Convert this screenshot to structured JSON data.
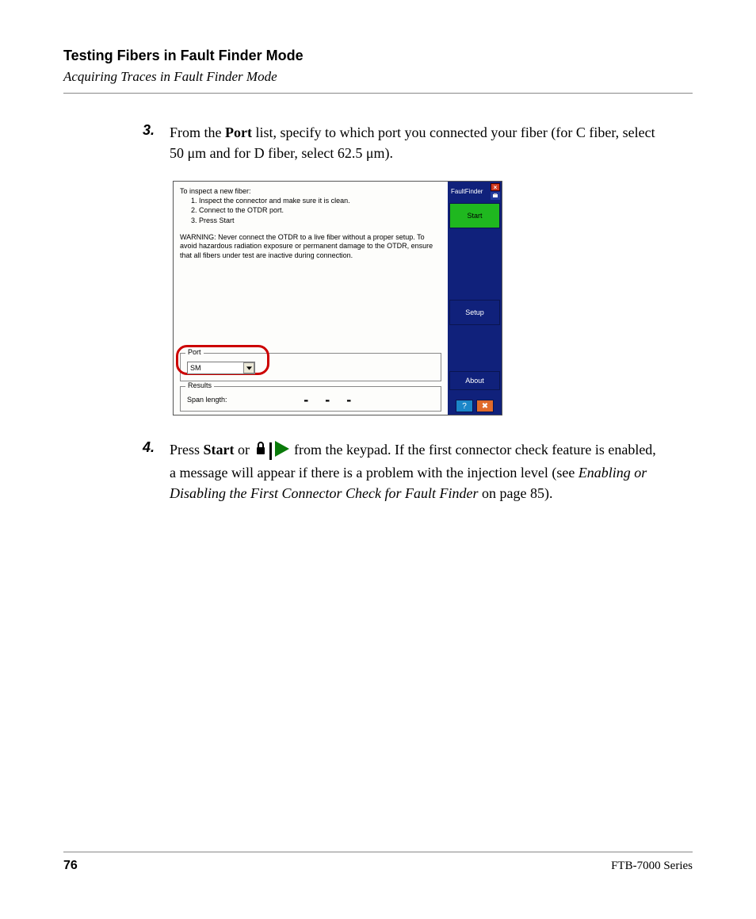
{
  "header": {
    "title": "Testing Fibers in Fault Finder Mode",
    "subtitle": "Acquiring Traces in Fault Finder Mode"
  },
  "steps": {
    "s3": {
      "num": "3.",
      "pre": "From the ",
      "bold1": "Port",
      "mid": " list, specify to which port you connected your fiber (for C fiber, select 50 μm and for D fiber, select 62.5 μm)."
    },
    "s4": {
      "num": "4.",
      "pre": "Press ",
      "bold1": "Start",
      "mid1": " or ",
      "mid2": " from the keypad. If the first connector check feature is enabled, a message will appear if there is a problem with the injection level (see ",
      "ital": "Enabling or Disabling the First Connector Check for Fault Finder",
      "post": " on page 85)."
    }
  },
  "app": {
    "instr_title": "To inspect a new fiber:",
    "instr_items": [
      "1. Inspect the connector and make sure it is clean.",
      "2. Connect to the OTDR port.",
      "3. Press Start"
    ],
    "warning": "WARNING: Never connect the OTDR to a live fiber without a proper setup. To avoid hazardous radiation exposure or permanent damage to the OTDR, ensure that all fibers under test are inactive during connection.",
    "port_group_label": "Port",
    "port_value": "SM",
    "results_group_label": "Results",
    "span_length_label": "Span length:",
    "span_length_value": "- - -",
    "sidebar": {
      "title": "FaultFinder",
      "start": "Start",
      "setup": "Setup",
      "about": "About",
      "help_glyph": "?",
      "close_glyph": "✖",
      "top_close_glyph": "×"
    }
  },
  "footer": {
    "page": "76",
    "series": "FTB-7000 Series"
  }
}
